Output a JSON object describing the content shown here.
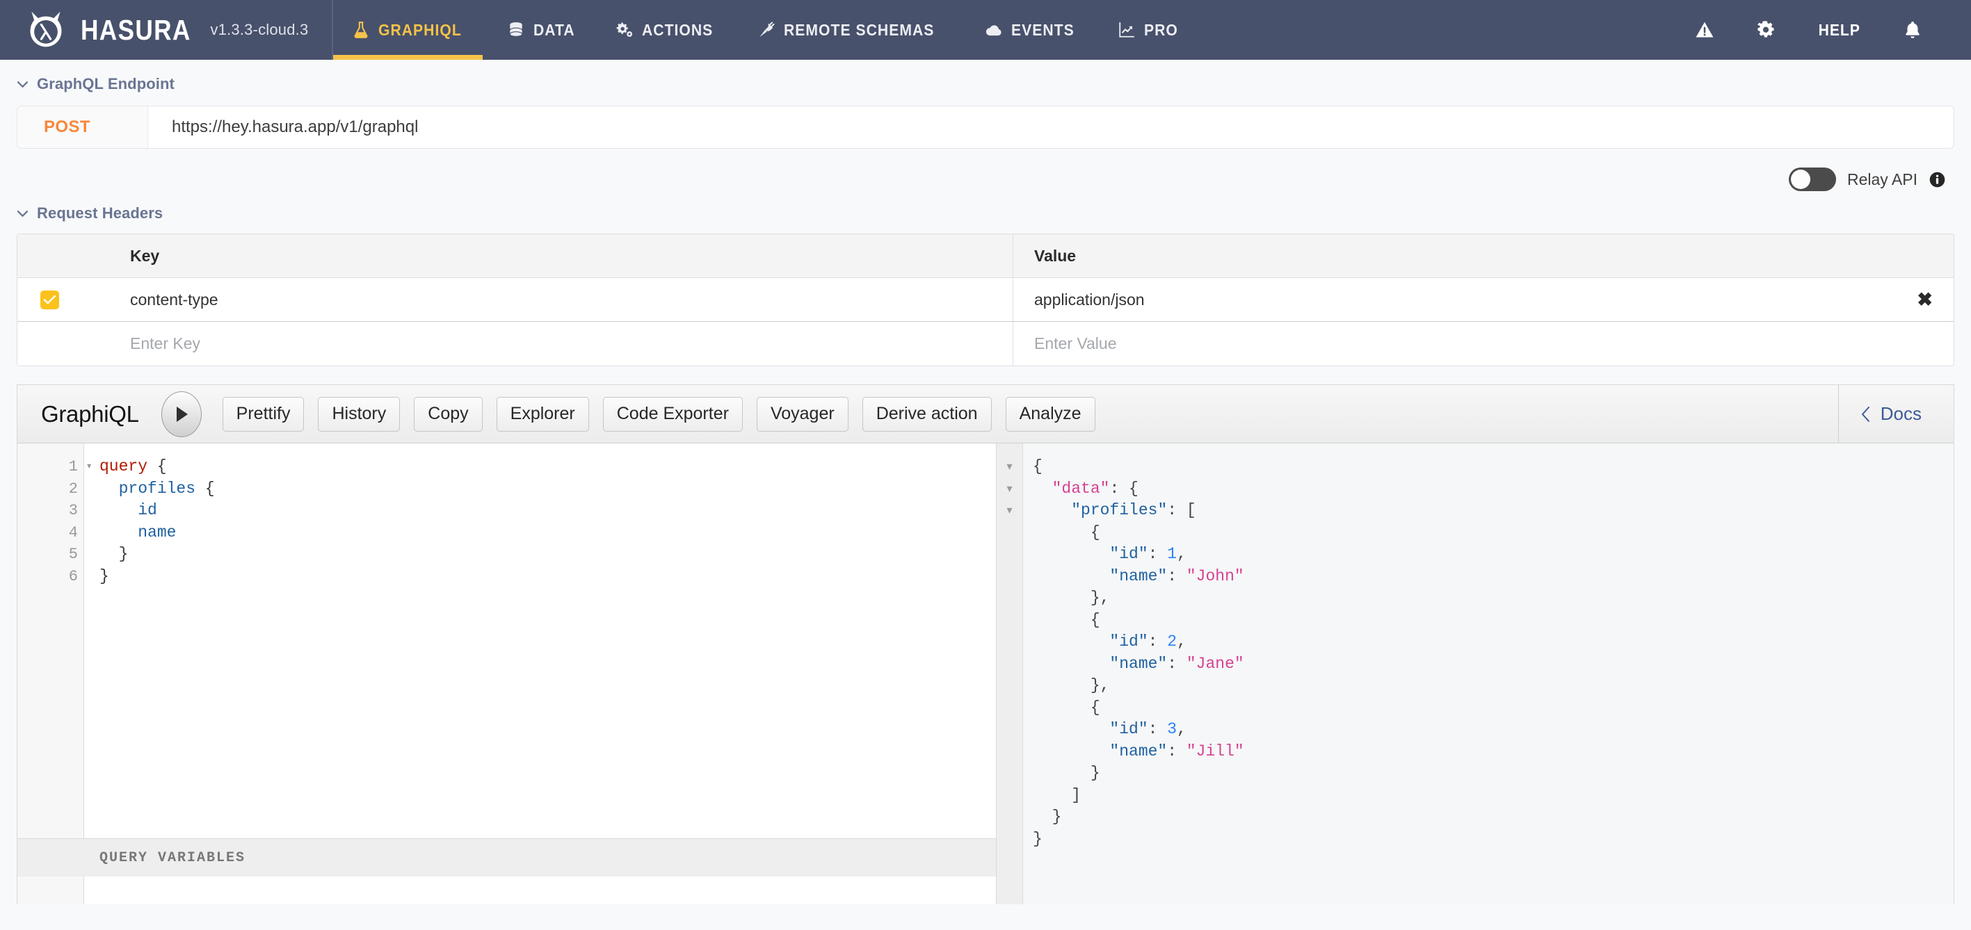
{
  "topnav": {
    "brand_name": "HASURA",
    "version": "v1.3.3-cloud.3",
    "items": [
      {
        "label": "GRAPHIQL",
        "icon": "flask-icon",
        "active": true
      },
      {
        "label": "DATA",
        "icon": "database-icon",
        "active": false
      },
      {
        "label": "ACTIONS",
        "icon": "gears-icon",
        "active": false
      },
      {
        "label": "REMOTE SCHEMAS",
        "icon": "plug-icon",
        "active": false
      },
      {
        "label": "EVENTS",
        "icon": "cloud-icon",
        "active": false
      },
      {
        "label": "PRO",
        "icon": "line-chart-icon",
        "active": false
      }
    ],
    "help_label": "HELP",
    "right_icons": [
      "warning-icon",
      "gear-icon",
      "bell-icon"
    ],
    "accent_color": "#f5c24a",
    "background_color": "#48516b"
  },
  "endpoint": {
    "section_title": "GraphQL Endpoint",
    "method": "POST",
    "url": "https://hey.hasura.app/v1/graphql",
    "method_color": "#f7873c"
  },
  "relay": {
    "label": "Relay API",
    "enabled": false,
    "info_icon": "info-icon"
  },
  "request_headers": {
    "section_title": "Request Headers",
    "columns": [
      "Key",
      "Value"
    ],
    "rows": [
      {
        "enabled": true,
        "key": "content-type",
        "value": "application/json"
      }
    ],
    "new_row": {
      "key_placeholder": "Enter Key",
      "value_placeholder": "Enter Value"
    },
    "remove_icon": "✖",
    "checkbox_color": "#fcc21b"
  },
  "graphiql": {
    "title": "GraphiQL",
    "execute_icon": "play-icon",
    "buttons": [
      "Prettify",
      "History",
      "Copy",
      "Explorer",
      "Code Exporter",
      "Voyager",
      "Derive action",
      "Analyze"
    ],
    "docs_label": "Docs",
    "docs_chevron": "chevron-left-icon",
    "query_variables_label": "QUERY VARIABLES",
    "editor": {
      "line_numbers": [
        "1",
        "2",
        "3",
        "4",
        "5",
        "6"
      ],
      "lines": [
        [
          {
            "t": "query",
            "c": "k-query"
          },
          {
            "t": " {",
            "c": "k-punct"
          }
        ],
        [
          {
            "t": "  ",
            "c": "k-punct"
          },
          {
            "t": "profiles",
            "c": "k-field"
          },
          {
            "t": " {",
            "c": "k-punct"
          }
        ],
        [
          {
            "t": "    ",
            "c": "k-punct"
          },
          {
            "t": "id",
            "c": "k-field"
          }
        ],
        [
          {
            "t": "    ",
            "c": "k-punct"
          },
          {
            "t": "name",
            "c": "k-field"
          }
        ],
        [
          {
            "t": "  }",
            "c": "k-punct"
          }
        ],
        [
          {
            "t": "}",
            "c": "k-punct"
          }
        ]
      ]
    },
    "response": {
      "fold_markers": 3,
      "lines": [
        [
          {
            "t": "{",
            "c": "j-punct"
          }
        ],
        [
          {
            "t": "  ",
            "c": "j-punct"
          },
          {
            "t": "\"data\"",
            "c": "j-key-top"
          },
          {
            "t": ": {",
            "c": "j-punct"
          }
        ],
        [
          {
            "t": "    ",
            "c": "j-punct"
          },
          {
            "t": "\"profiles\"",
            "c": "j-key"
          },
          {
            "t": ": [",
            "c": "j-punct"
          }
        ],
        [
          {
            "t": "      {",
            "c": "j-punct"
          }
        ],
        [
          {
            "t": "        ",
            "c": "j-punct"
          },
          {
            "t": "\"id\"",
            "c": "j-key"
          },
          {
            "t": ": ",
            "c": "j-punct"
          },
          {
            "t": "1",
            "c": "j-num"
          },
          {
            "t": ",",
            "c": "j-punct"
          }
        ],
        [
          {
            "t": "        ",
            "c": "j-punct"
          },
          {
            "t": "\"name\"",
            "c": "j-key"
          },
          {
            "t": ": ",
            "c": "j-punct"
          },
          {
            "t": "\"John\"",
            "c": "j-str"
          }
        ],
        [
          {
            "t": "      },",
            "c": "j-punct"
          }
        ],
        [
          {
            "t": "      {",
            "c": "j-punct"
          }
        ],
        [
          {
            "t": "        ",
            "c": "j-punct"
          },
          {
            "t": "\"id\"",
            "c": "j-key"
          },
          {
            "t": ": ",
            "c": "j-punct"
          },
          {
            "t": "2",
            "c": "j-num"
          },
          {
            "t": ",",
            "c": "j-punct"
          }
        ],
        [
          {
            "t": "        ",
            "c": "j-punct"
          },
          {
            "t": "\"name\"",
            "c": "j-key"
          },
          {
            "t": ": ",
            "c": "j-punct"
          },
          {
            "t": "\"Jane\"",
            "c": "j-str"
          }
        ],
        [
          {
            "t": "      },",
            "c": "j-punct"
          }
        ],
        [
          {
            "t": "      {",
            "c": "j-punct"
          }
        ],
        [
          {
            "t": "        ",
            "c": "j-punct"
          },
          {
            "t": "\"id\"",
            "c": "j-key"
          },
          {
            "t": ": ",
            "c": "j-punct"
          },
          {
            "t": "3",
            "c": "j-num"
          },
          {
            "t": ",",
            "c": "j-punct"
          }
        ],
        [
          {
            "t": "        ",
            "c": "j-punct"
          },
          {
            "t": "\"name\"",
            "c": "j-key"
          },
          {
            "t": ": ",
            "c": "j-punct"
          },
          {
            "t": "\"Jill\"",
            "c": "j-str"
          }
        ],
        [
          {
            "t": "      }",
            "c": "j-punct"
          }
        ],
        [
          {
            "t": "    ]",
            "c": "j-punct"
          }
        ],
        [
          {
            "t": "  }",
            "c": "j-punct"
          }
        ],
        [
          {
            "t": "}",
            "c": "j-punct"
          }
        ]
      ],
      "result_data": {
        "data": {
          "profiles": [
            {
              "id": 1,
              "name": "John"
            },
            {
              "id": 2,
              "name": "Jane"
            },
            {
              "id": 3,
              "name": "Jill"
            }
          ]
        }
      }
    }
  }
}
